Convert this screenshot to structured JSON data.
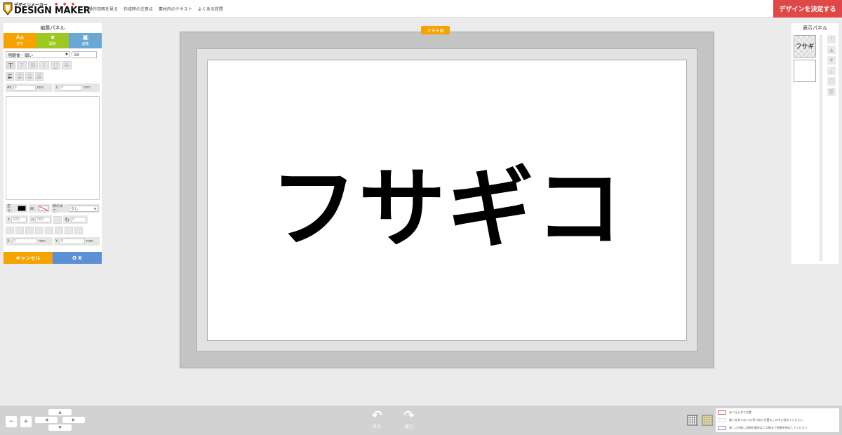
{
  "header": {
    "logo_small": "デザインメーカー",
    "logo_big": "DESIGN MAKER",
    "nav": [
      "操作説明を見る",
      "作成時の注意点",
      "素材内のテキスト",
      "よくある質問"
    ],
    "decide_button": "デザインを決定する"
  },
  "edit_panel": {
    "title": "編集パネル",
    "tabs": [
      "文字",
      "図形",
      "画像"
    ],
    "font_family": "明朝体・細い",
    "font_size": "16",
    "letter_spacing": "0",
    "line_spacing": "0",
    "unit": "mm",
    "fill_label": "塗り：",
    "line_label": "線：",
    "line_width_label": "線の太さ：",
    "line_width_value": "なし",
    "height_value": "100",
    "width_value": "100",
    "rotation": "0",
    "x_label": "X:",
    "x_value": "0",
    "y_label": "Y:",
    "y_value": "0",
    "cancel_button": "キャンセル",
    "ok_button": "O K"
  },
  "canvas": {
    "side_label": "オモテ面",
    "main_text": "フサギコ"
  },
  "display_panel": {
    "title": "表示パネル",
    "layer_text": "フサギ"
  },
  "bottom_bar": {
    "undo_label": "戻る",
    "redo_label": "進む",
    "legend": [
      {
        "color": "#e05a5a",
        "text": "赤＝仕上がり位置"
      },
      {
        "color": "#ffffff",
        "text": "緑＝文字でおいろ/切り取り位置をこの中に収めてください"
      },
      {
        "color": "#9b8fd8",
        "text": "青＝ふち無し印刷の場合はこの線まで画像を伸ばしてください"
      }
    ]
  },
  "colors": {
    "accent_orange": "#f5a300",
    "accent_green": "#9dc822",
    "accent_blue": "#6aa8d4",
    "decide_red": "#e04848",
    "ok_blue": "#5b8fd6"
  }
}
